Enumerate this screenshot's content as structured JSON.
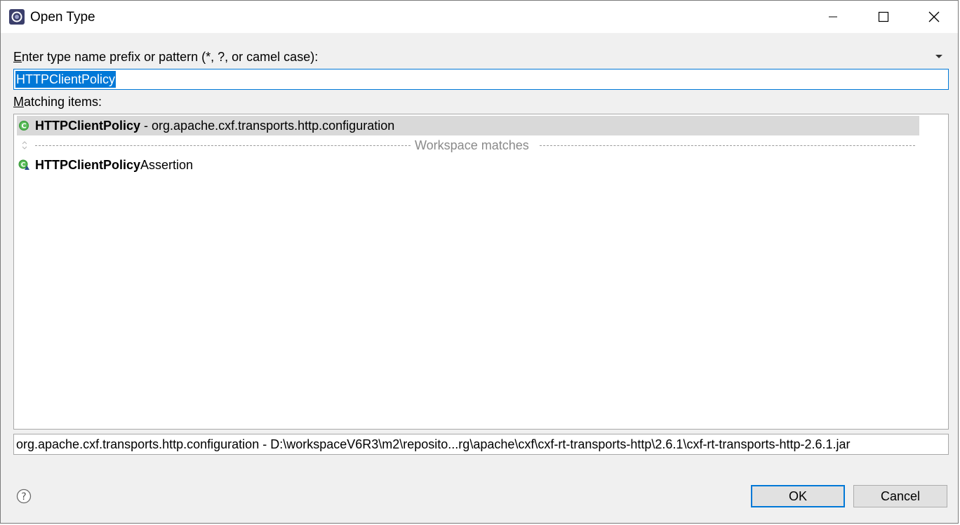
{
  "window": {
    "title": "Open Type",
    "icon": "eclipse-icon"
  },
  "filter": {
    "label_mnemonic": "E",
    "label_rest": "nter type name prefix or pattern (*, ?, or camel case):",
    "value": "HTTPClientPolicy"
  },
  "matching": {
    "label_mnemonic": "M",
    "label_rest": "atching items:",
    "items": [
      {
        "bold": "HTTPClientPolicy",
        "rest": " - org.apache.cxf.transports.http.configuration",
        "icon": "class-icon",
        "selected": true
      },
      {
        "bold": "HTTPClientPolicy",
        "rest": "Assertion",
        "icon": "class-workspace-icon",
        "selected": false
      }
    ],
    "separator_label": "Workspace matches"
  },
  "details": {
    "text": "org.apache.cxf.transports.http.configuration - D:\\workspaceV6R3\\m2\\reposito...rg\\apache\\cxf\\cxf-rt-transports-http\\2.6.1\\cxf-rt-transports-http-2.6.1.jar"
  },
  "buttons": {
    "ok": "OK",
    "cancel": "Cancel"
  },
  "colors": {
    "accent": "#0078d7",
    "selection_bg": "#d9d9d9",
    "class_icon_green": "#3a9b3a"
  }
}
